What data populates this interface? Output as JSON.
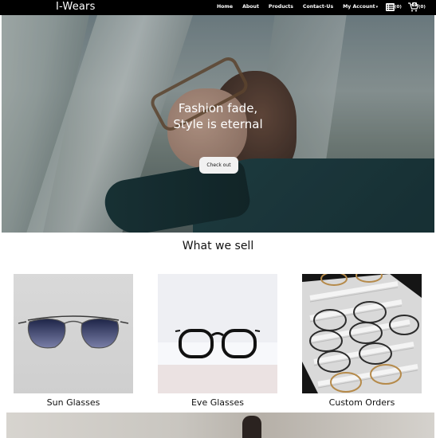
{
  "brand": "I-Wears",
  "nav": {
    "links": [
      "Home",
      "About",
      "Products",
      "Contact-Us"
    ],
    "account": "My Account",
    "list_count": "(0)",
    "cart_count": "(0)",
    "cart_badge": "0"
  },
  "hero": {
    "title_line1": "Fashion fade,",
    "title_line2": "Style is eternal",
    "cta": "Check out"
  },
  "section": {
    "title": "What we sell",
    "cards": [
      {
        "name": "Sun Glasses"
      },
      {
        "name": "Eve Glasses"
      },
      {
        "name": "Custom Orders"
      }
    ]
  },
  "colors": {
    "navbar_bg": "#000000",
    "button_bg": "#f1f1f1",
    "text": "#111111"
  },
  "icons": [
    "list-icon",
    "cart-icon",
    "caret-down-icon"
  ]
}
